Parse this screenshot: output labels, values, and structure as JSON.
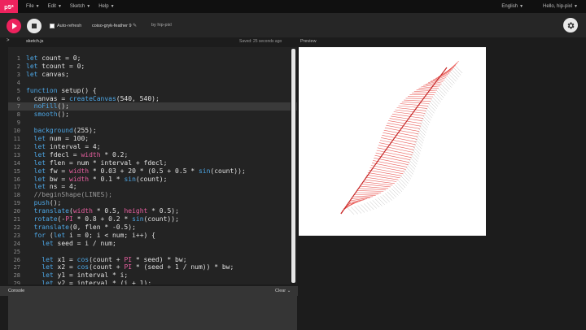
{
  "menubar": {
    "logo": "p5*",
    "items": [
      {
        "label": "File"
      },
      {
        "label": "Edit"
      },
      {
        "label": "Sketch"
      },
      {
        "label": "Help"
      }
    ],
    "language": "English",
    "user": "Hello, hip-pixl"
  },
  "toolbar": {
    "auto_refresh_label": "Auto-refresh",
    "sketch_name": "coiso-gryk-feather 9",
    "author": "by hip-pixl"
  },
  "editor": {
    "file_tab": "sketch.js",
    "saved_text": "Saved: 25 seconds ago",
    "sidebar_toggle": ">",
    "lines": [
      {
        "num": "1",
        "text": "let count = 0;"
      },
      {
        "num": "2",
        "text": "let tcount = 0;"
      },
      {
        "num": "3",
        "text": "let canvas;"
      },
      {
        "num": "4",
        "text": ""
      },
      {
        "num": "5",
        "text": "function setup() {"
      },
      {
        "num": "6",
        "text": "  canvas = createCanvas(540, 540);"
      },
      {
        "num": "7",
        "text": "  noFill();"
      },
      {
        "num": "8",
        "text": "  smooth();"
      },
      {
        "num": "9",
        "text": ""
      },
      {
        "num": "10",
        "text": "  background(255);"
      },
      {
        "num": "11",
        "text": "  let num = 100;"
      },
      {
        "num": "12",
        "text": "  let interval = 4;"
      },
      {
        "num": "13",
        "text": "  let fdecl = width * 0.2;"
      },
      {
        "num": "14",
        "text": "  let flen = num * interval + fdecl;"
      },
      {
        "num": "15",
        "text": "  let fw = width * 0.03 + 20 * (0.5 + 0.5 * sin(count));"
      },
      {
        "num": "16",
        "text": "  let bw = width * 0.1 * sin(count);"
      },
      {
        "num": "17",
        "text": "  let ns = 4;"
      },
      {
        "num": "18",
        "text": "  //beginShape(LINES);"
      },
      {
        "num": "19",
        "text": "  push();"
      },
      {
        "num": "20",
        "text": "  translate(width * 0.5, height * 0.5);"
      },
      {
        "num": "21",
        "text": "  rotate(-PI * 0.8 + 0.2 * sin(count));"
      },
      {
        "num": "22",
        "text": "  translate(0, flen * -0.5);"
      },
      {
        "num": "23",
        "text": "  for (let i = 0; i < num; i++) {"
      },
      {
        "num": "24",
        "text": "    let seed = i / num;"
      },
      {
        "num": "25",
        "text": ""
      },
      {
        "num": "26",
        "text": "    let x1 = cos(count + PI * seed) * bw;"
      },
      {
        "num": "27",
        "text": "    let x2 = cos(count + PI * (seed + 1 / num)) * bw;"
      },
      {
        "num": "28",
        "text": "    let y1 = interval * i;"
      },
      {
        "num": "29",
        "text": "    let y2 = interval * (i + 1);"
      }
    ]
  },
  "console": {
    "title": "Console",
    "clear_label": "Clear"
  },
  "preview": {
    "label": "Preview"
  },
  "colors": {
    "accent": "#ed225d",
    "feather": "#e53935"
  }
}
